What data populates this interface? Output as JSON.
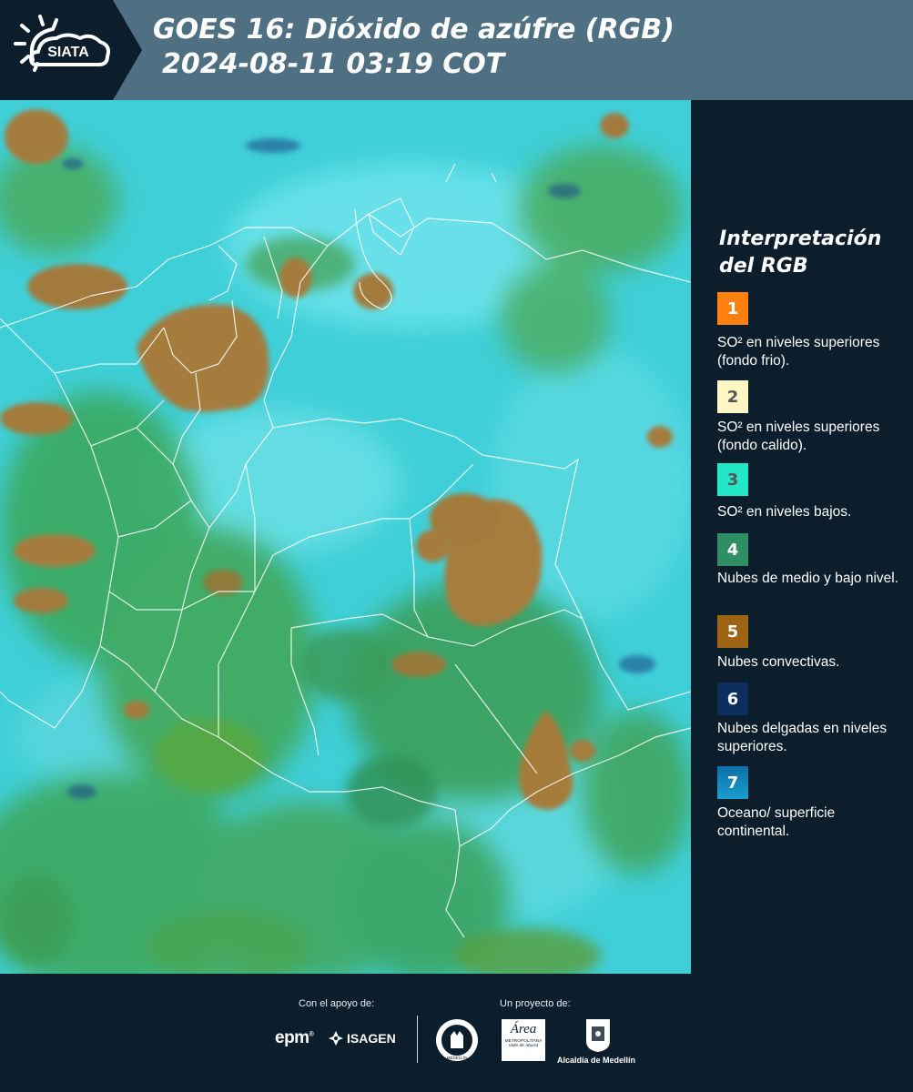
{
  "header": {
    "brand": "SIATA",
    "title_line1": "GOES 16: Dióxido de azúfre (RGB)",
    "title_line2": "2024-08-11 03:19 COT",
    "bg_color": "#4e7082"
  },
  "map": {
    "description_colors": {
      "ocean": "#3ccfd6",
      "low_clouds": "#2f9a5a",
      "convective": "#a8813a",
      "borders": "#ffffff"
    }
  },
  "legend": {
    "title": "Interpretación del RGB",
    "items": [
      {
        "num": "1",
        "color": "#ff7f0f",
        "label": "SO² en niveles superiores (fondo frio)."
      },
      {
        "num": "2",
        "color": "#fff6c4",
        "label": "SO² en niveles superiores (fondo calido)."
      },
      {
        "num": "3",
        "color": "#22e8c8",
        "label": "SO² en niveles bajos."
      },
      {
        "num": "4",
        "color": "#2f8f64",
        "label": "Nubes de medio y bajo nivel."
      },
      {
        "num": "5",
        "color": "#9c6413",
        "label": "Nubes convectivas."
      },
      {
        "num": "6",
        "color": "#0d2d5c",
        "label": "Nubes delgadas en niveles superiores."
      },
      {
        "num": "7",
        "color": "#1583b8",
        "label": "Oceano/ superficie continental."
      }
    ]
  },
  "footer": {
    "support_caption": "Con el apoyo de:",
    "project_caption": "Un proyecto de:",
    "epm": "epm",
    "isagen": "ISAGEN",
    "area_name": "Área",
    "area_sub1": "METROPOLITANA",
    "area_sub2": "Valle de Aburrá",
    "alcaldia": "Alcaldía de Medellín",
    "seal_text": "MEDELLÍN"
  }
}
